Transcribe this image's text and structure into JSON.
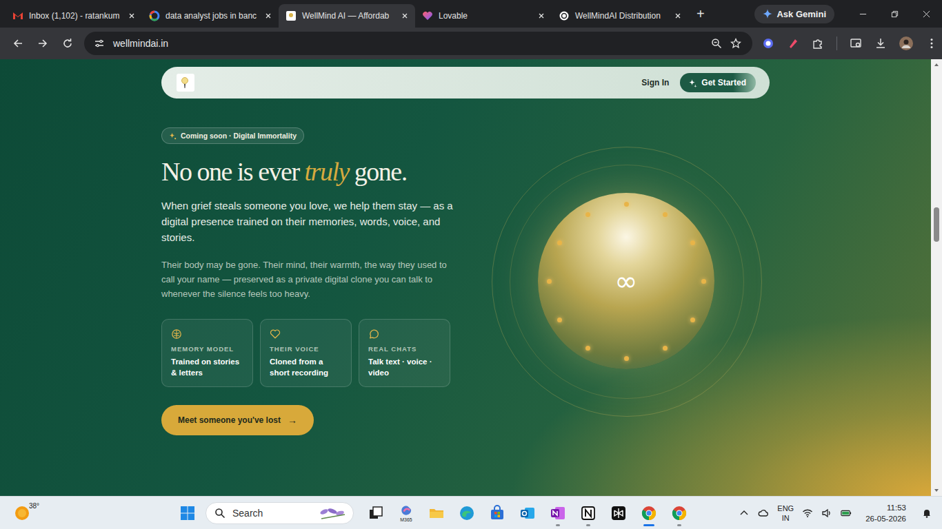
{
  "browser": {
    "tabs": [
      {
        "label": "Inbox (1,102) - ratankum",
        "kind": "gmail",
        "selected": false
      },
      {
        "label": "data analyst jobs in banc",
        "kind": "google",
        "selected": false
      },
      {
        "label": "WellMind AI — Affordab",
        "kind": "wellmind",
        "selected": true
      },
      {
        "label": "Lovable",
        "kind": "lovable",
        "selected": false
      },
      {
        "label": "WellMindAI Distribution",
        "kind": "chatgpt",
        "selected": false
      }
    ],
    "new_tab": "+",
    "gemini_button": "Ask Gemini",
    "url": "wellmindai.in",
    "scrollbar": {
      "level": 0.33
    }
  },
  "page": {
    "nav": {
      "sign_in": "Sign In",
      "cta": "Get Started"
    },
    "hero": {
      "badge": "Coming soon · Digital Immortality",
      "headline": {
        "before": "No one is ever ",
        "accent": "truly",
        "after": " gone."
      },
      "lead": "When grief steals someone you love, we help them stay — as a digital presence trained on their memories, words, voice, and stories.",
      "body": "Their body may be gone. Their mind, their warmth, the way they used to call your name — preserved as a private digital clone you can talk to whenever the silence feels too heavy.",
      "features": [
        {
          "kind": "brain",
          "label": "MEMORY MODEL",
          "text": "Trained on stories & letters"
        },
        {
          "kind": "heart",
          "label": "THEIR VOICE",
          "text": "Cloned from a short recording"
        },
        {
          "kind": "chat",
          "label": "REAL CHATS",
          "text": "Talk text · voice · video"
        }
      ],
      "button": "Meet someone you've lost",
      "button_arrow": "→",
      "orb_symbol": "∞"
    }
  },
  "taskbar": {
    "weather": "38°",
    "search": "Search",
    "apps": [
      {
        "kind": "taskview",
        "open": false,
        "selected": false
      },
      {
        "kind": "m365",
        "label": "M365",
        "open": false,
        "selected": false
      },
      {
        "kind": "explorer",
        "open": false,
        "selected": false
      },
      {
        "kind": "edge",
        "open": false,
        "selected": false
      },
      {
        "kind": "store",
        "open": false,
        "selected": false
      },
      {
        "kind": "outlook",
        "open": false,
        "selected": false
      },
      {
        "kind": "onenote",
        "open": true,
        "selected": false
      },
      {
        "kind": "notion",
        "open": true,
        "selected": false
      },
      {
        "kind": "perplexity",
        "open": false,
        "selected": false
      },
      {
        "kind": "chrome",
        "open": true,
        "selected": true
      },
      {
        "kind": "chrome",
        "open": true,
        "selected": false
      }
    ],
    "language": [
      "ENG",
      "IN"
    ],
    "time": "11:53",
    "date": "26-05-2026"
  }
}
